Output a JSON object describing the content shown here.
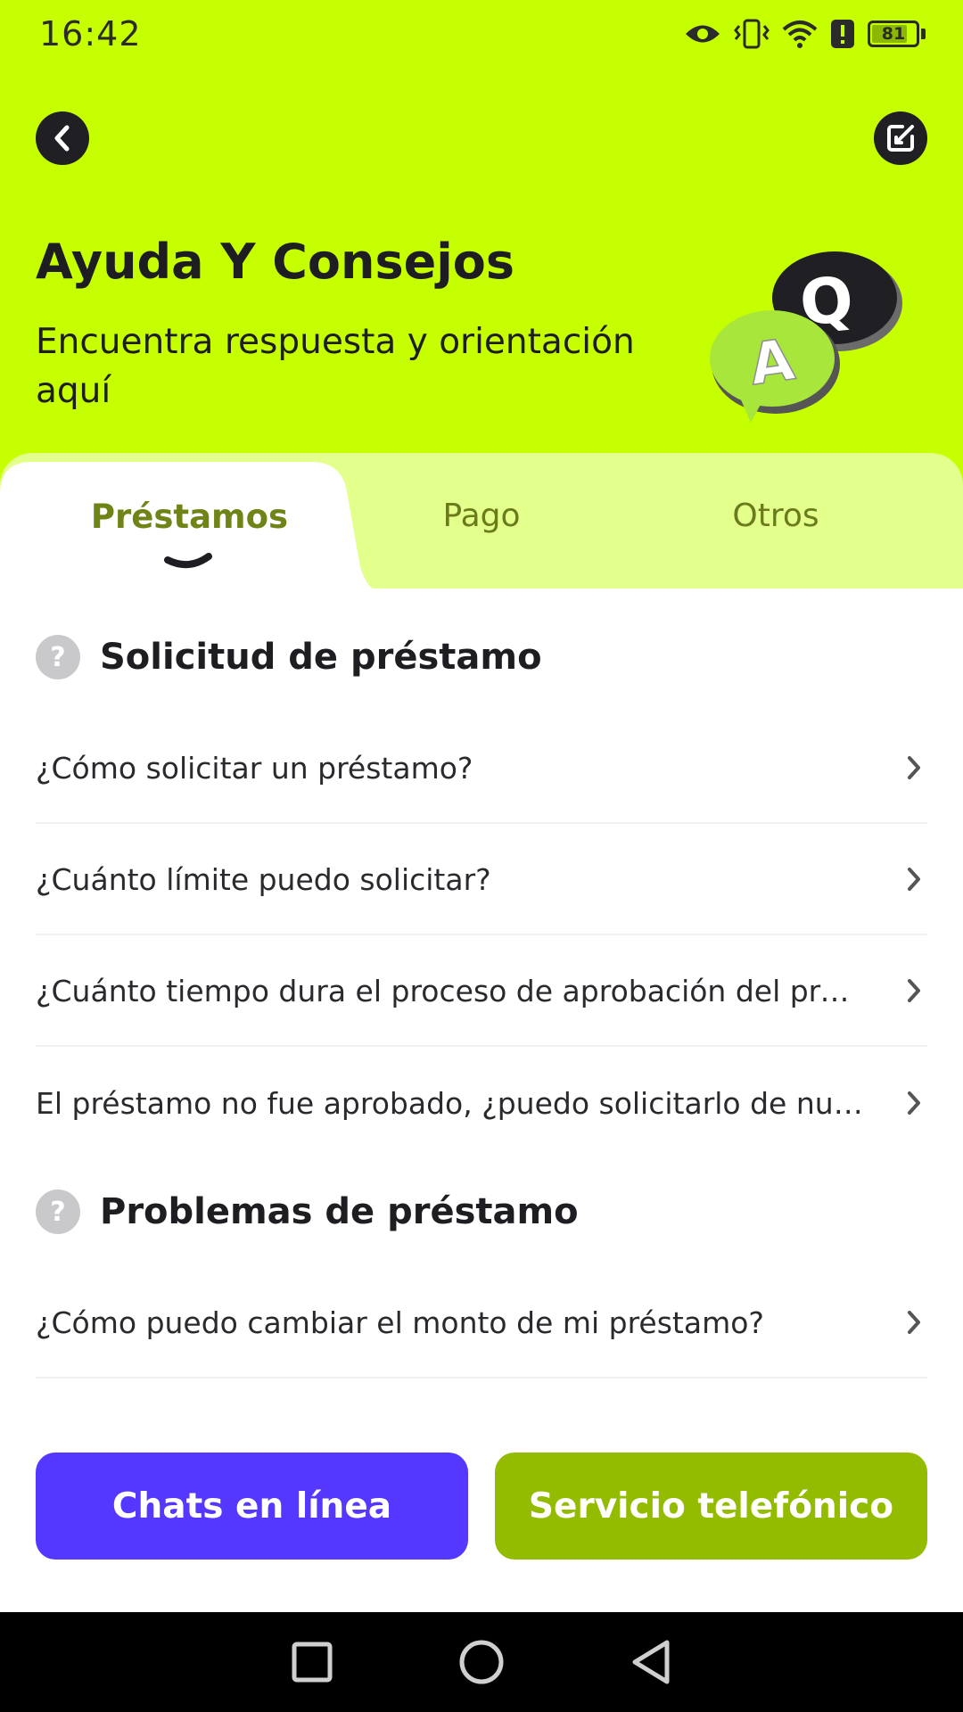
{
  "status_bar": {
    "time": "16:42",
    "battery_level": "81",
    "battery_fraction": 0.81,
    "icons": [
      "eye-icon",
      "vibrate-icon",
      "wifi-icon",
      "alert-icon",
      "battery-icon"
    ]
  },
  "header": {
    "back_icon": "chevron-left-icon",
    "edit_icon": "edit-icon",
    "title": "Ayuda Y Consejos",
    "subtitle": "Encuentra respuesta y orientación aquí",
    "illustration_q": "Q",
    "illustration_a": "A"
  },
  "tabs": [
    {
      "label": "Préstamos",
      "active": true
    },
    {
      "label": "Pago",
      "active": false
    },
    {
      "label": "Otros",
      "active": false
    }
  ],
  "sections": [
    {
      "title": "Solicitud de préstamo",
      "icon": "?",
      "items": [
        "¿Cómo solicitar un préstamo?",
        "¿Cuánto límite puedo solicitar?",
        "¿Cuánto tiempo dura el proceso de aprobación del préstamo?",
        "El préstamo no fue aprobado, ¿puedo solicitarlo de nuevo?"
      ]
    },
    {
      "title": "Problemas de préstamo",
      "icon": "?",
      "items": [
        "¿Cómo puedo cambiar el monto de mi préstamo?"
      ]
    }
  ],
  "actions": {
    "chat_label": "Chats en línea",
    "phone_label": "Servicio telefónico"
  },
  "colors": {
    "brand_green": "#c6ff00",
    "tab_strip": "#e3ff8c",
    "chat_button": "#5538ff",
    "phone_button": "#93bb00"
  }
}
